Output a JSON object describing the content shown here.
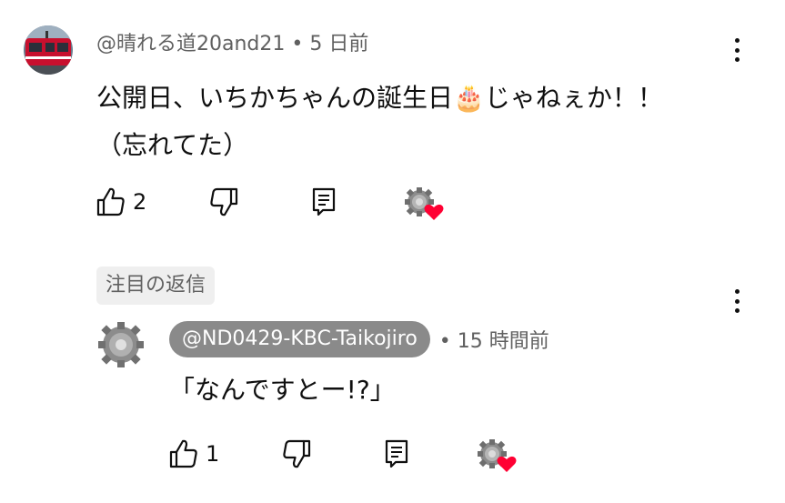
{
  "comment": {
    "author": "@晴れる道20and21",
    "separator": "•",
    "time": "5 日前",
    "text_line1": "公開日、いちかちゃんの誕生日🎂じゃねぇか！！",
    "text_line2": "（忘れてた）",
    "like_count": "2",
    "avatar": "red-train-avatar",
    "menu_icon": "more-vert-icon"
  },
  "highlight": {
    "label": "注目の返信"
  },
  "reply": {
    "handle": "@ND0429-KBC-Taikojiro",
    "separator": "•",
    "time": "15 時間前",
    "text": "「なんですとー!?」",
    "like_count": "1",
    "avatar": "gear-avatar",
    "menu_icon": "more-vert-icon"
  },
  "colors": {
    "secondary_text": "#606060",
    "chip_bg": "#efefef",
    "handle_chip_bg": "#8a8a8a",
    "heart": "#ff0033"
  }
}
